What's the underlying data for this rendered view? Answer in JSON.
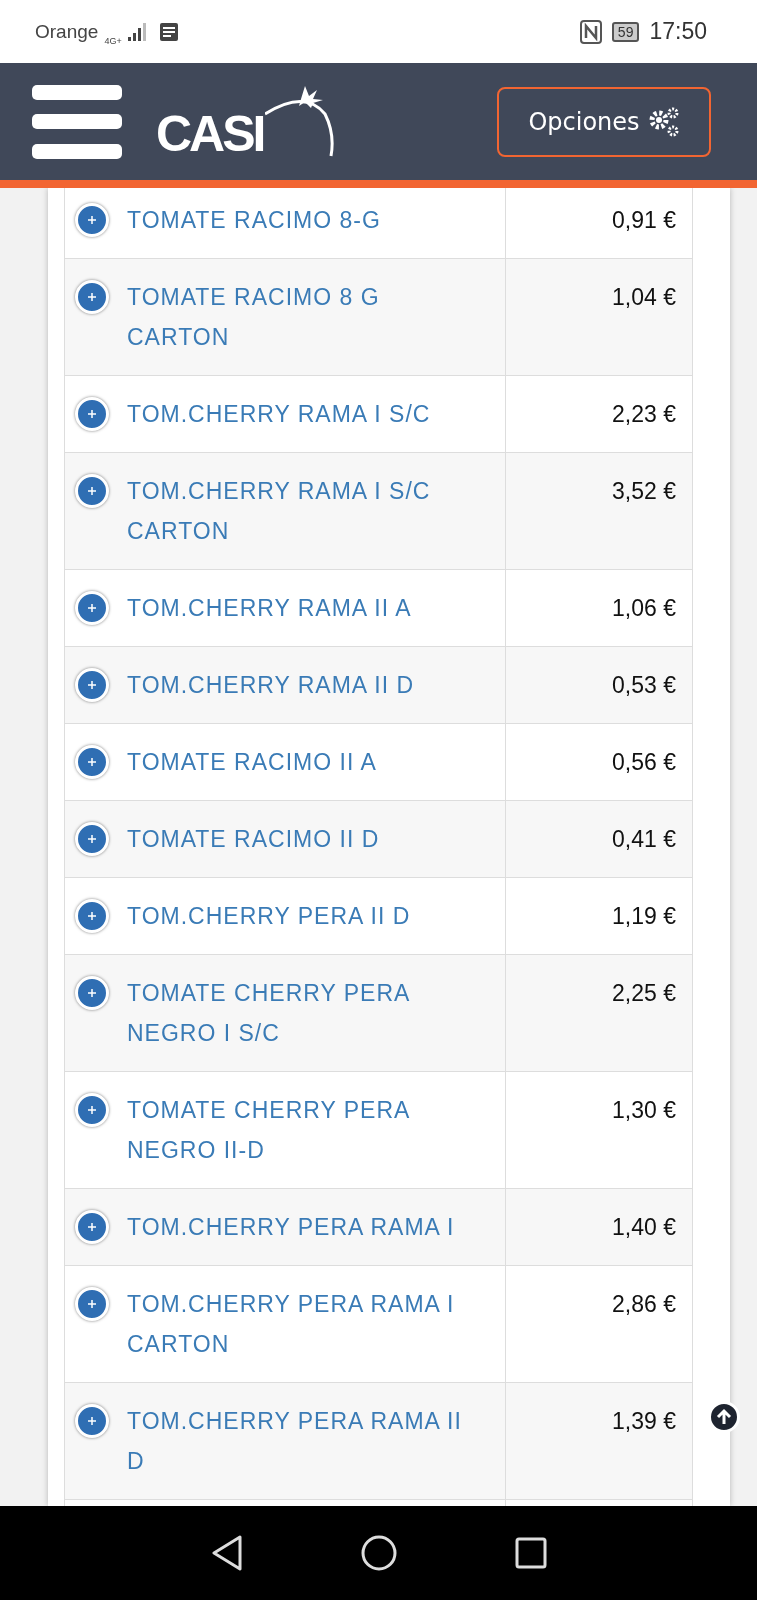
{
  "status_bar": {
    "carrier": "Orange",
    "network": "4G+",
    "battery": "59",
    "time": "17:50"
  },
  "header": {
    "logo": "CASI",
    "options_button": "Opciones"
  },
  "rows": [
    {
      "name": "TOMATE RACIMO 8-G",
      "price": "0,91 €"
    },
    {
      "name": "TOMATE RACIMO 8 G CARTON",
      "price": "1,04 €"
    },
    {
      "name": "TOM.CHERRY RAMA I S/C",
      "price": "2,23 €"
    },
    {
      "name": "TOM.CHERRY RAMA I S/C CARTON",
      "price": "3,52 €"
    },
    {
      "name": "TOM.CHERRY RAMA II A",
      "price": "1,06 €"
    },
    {
      "name": "TOM.CHERRY RAMA II D",
      "price": "0,53 €"
    },
    {
      "name": "TOMATE RACIMO II A",
      "price": "0,56 €"
    },
    {
      "name": "TOMATE RACIMO II D",
      "price": "0,41 €"
    },
    {
      "name": "TOM.CHERRY PERA II D",
      "price": "1,19 €"
    },
    {
      "name": "TOMATE CHERRY PERA NEGRO I S/C",
      "price": "2,25 €"
    },
    {
      "name": "TOMATE CHERRY PERA NEGRO II-D",
      "price": "1,30 €"
    },
    {
      "name": "TOM.CHERRY PERA RAMA I",
      "price": "1,40 €"
    },
    {
      "name": "TOM.CHERRY PERA RAMA I CARTON",
      "price": "2,86 €"
    },
    {
      "name": "TOM.CHERRY PERA RAMA II D",
      "price": "1,39 €"
    }
  ]
}
